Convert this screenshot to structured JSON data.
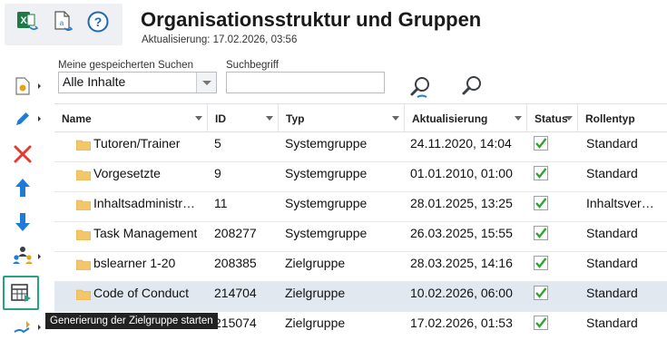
{
  "header": {
    "title": "Organisationsstruktur und Gruppen",
    "subtitle": "Aktualisierung: 17.02.2026, 03:56"
  },
  "filters": {
    "saved_search_label": "Meine gespeicherten Suchen",
    "saved_search_value": "Alle Inhalte",
    "search_term_label": "Suchbegriff",
    "search_term_value": ""
  },
  "table": {
    "columns": [
      "Name",
      "ID",
      "Typ",
      "Aktualisierung",
      "Status",
      "Rollentyp"
    ],
    "rows": [
      {
        "name": "Tutoren/Trainer",
        "id": "5",
        "typ": "Systemgruppe",
        "aktualisierung": "24.11.2020, 14:04",
        "status": true,
        "rollentyp": "Standard",
        "selected": false
      },
      {
        "name": "Vorgesetzte",
        "id": "9",
        "typ": "Systemgruppe",
        "aktualisierung": "01.01.2010, 01:00",
        "status": true,
        "rollentyp": "Standard",
        "selected": false
      },
      {
        "name": "Inhaltsadministr…",
        "id": "11",
        "typ": "Systemgruppe",
        "aktualisierung": "28.01.2025, 13:25",
        "status": true,
        "rollentyp": "Inhaltsver…",
        "selected": false
      },
      {
        "name": "Task Management",
        "id": "208277",
        "typ": "Systemgruppe",
        "aktualisierung": "26.03.2025, 15:55",
        "status": true,
        "rollentyp": "Standard",
        "selected": false
      },
      {
        "name": "bslearner 1-20",
        "id": "208385",
        "typ": "Zielgruppe",
        "aktualisierung": "28.03.2025, 14:16",
        "status": true,
        "rollentyp": "Standard",
        "selected": false
      },
      {
        "name": "Code of Conduct",
        "id": "214704",
        "typ": "Zielgruppe",
        "aktualisierung": "10.02.2026, 06:00",
        "status": true,
        "rollentyp": "Standard",
        "selected": true
      },
      {
        "name": "",
        "id": "215074",
        "typ": "Zielgruppe",
        "aktualisierung": "17.02.2026, 01:53",
        "status": true,
        "rollentyp": "Standard",
        "selected": false
      }
    ]
  },
  "tooltip": "Generierung der Zielgruppe starten",
  "colors": {
    "accent": "#1e7bd6",
    "delete": "#e23b2f",
    "highlight": "#22a584",
    "selected_row": "#e1e8ef"
  }
}
